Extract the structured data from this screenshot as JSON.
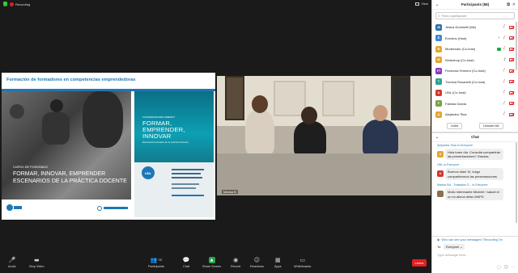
{
  "topbar": {
    "recording": "Recording",
    "view": "View"
  },
  "slide": {
    "header": "Formación de formadores en competencias emprendedoras",
    "course_small": "CURSO DE POSGRADO",
    "course_line1": "FORMAR, INNOVAR, EMPRENDER",
    "course_line2": "ESCENARIOS DE LA PRÁCTICA DOCENTE",
    "poster_small": "CONVERSATORIO ABIERTO",
    "poster_l1": "FORMAR,",
    "poster_l2": "EMPRENDER,",
    "poster_l3": "INNOVAR",
    "poster_sub": "Escenarios actuales de la práctica docente",
    "poster_logo": "UNL"
  },
  "video": {
    "name": "Marisa B"
  },
  "controls": [
    {
      "id": "audio",
      "label": "Audio",
      "icon": "🎤"
    },
    {
      "id": "stop-video",
      "label": "Stop Video",
      "icon": "▬"
    },
    {
      "id": "participants",
      "label": "Participants",
      "icon": "👥",
      "count": "58"
    },
    {
      "id": "chat",
      "label": "Chat",
      "icon": "💬"
    },
    {
      "id": "share",
      "label": "Share Screen",
      "icon": "▲"
    },
    {
      "id": "record",
      "label": "Record",
      "icon": "◉"
    },
    {
      "id": "reactions",
      "label": "Reactions",
      "icon": "☺"
    },
    {
      "id": "apps",
      "label": "Apps",
      "icon": "▦"
    },
    {
      "id": "whiteboards",
      "label": "Whiteboards",
      "icon": "▭"
    }
  ],
  "leave": "Leave",
  "participants": {
    "title": "Participants (58)",
    "search_placeholder": "Find a participant",
    "items": [
      {
        "initials": "JD",
        "name": "Jesica Dominelli (Me)",
        "color": "#2d6fa8"
      },
      {
        "initials": "E",
        "name": "Eventos (Host)",
        "color": "#3b8bd0"
      },
      {
        "initials": "M",
        "name": "Moderador (Co-host)",
        "color": "#e0a82e"
      },
      {
        "initials": "W",
        "name": "Workshop (Co-host)",
        "color": "#e0a82e"
      },
      {
        "initials": "FT",
        "name": "Florencia Tenreiro (Co-host)",
        "color": "#8a3ab8"
      },
      {
        "initials": "T",
        "name": "Técnica Rosanelli (Co-host)",
        "color": "#2aa58f"
      },
      {
        "initials": "U",
        "name": "UNL (Co-host)",
        "color": "#d0392b"
      },
      {
        "initials": "F",
        "name": "Fabiola Garcia",
        "color": "#7ba34a"
      },
      {
        "initials": "A",
        "name": "Alejandra Tilua",
        "color": "#e0a82e"
      }
    ],
    "invite": "Invite",
    "mute_me": "Unmute Me"
  },
  "chat": {
    "title": "Chat",
    "messages": [
      {
        "from": "Alejandra Tilua to Everyone",
        "body": "Hola buen día. Consulta compartirán las presentaciones? Gracias.",
        "initial": "A",
        "color": "#e0a82e"
      },
      {
        "from": "UNL to Everyone",
        "body": "Buenos días! Sí, luego compartiremos las presentaciones.",
        "initial": "U",
        "color": "#d0392b"
      },
      {
        "from": "Marina Sol - Traslados S... to Everyone",
        "body": "Muito interesante Michele ! saludi di un ex-alieva della UNIPD",
        "initial": "",
        "color": "#8a7050"
      }
    ],
    "who_can_see": "Who can see your messages? Recording On",
    "to_label": "To:",
    "to_value": "Everyone",
    "input_placeholder": "Type message here..."
  }
}
